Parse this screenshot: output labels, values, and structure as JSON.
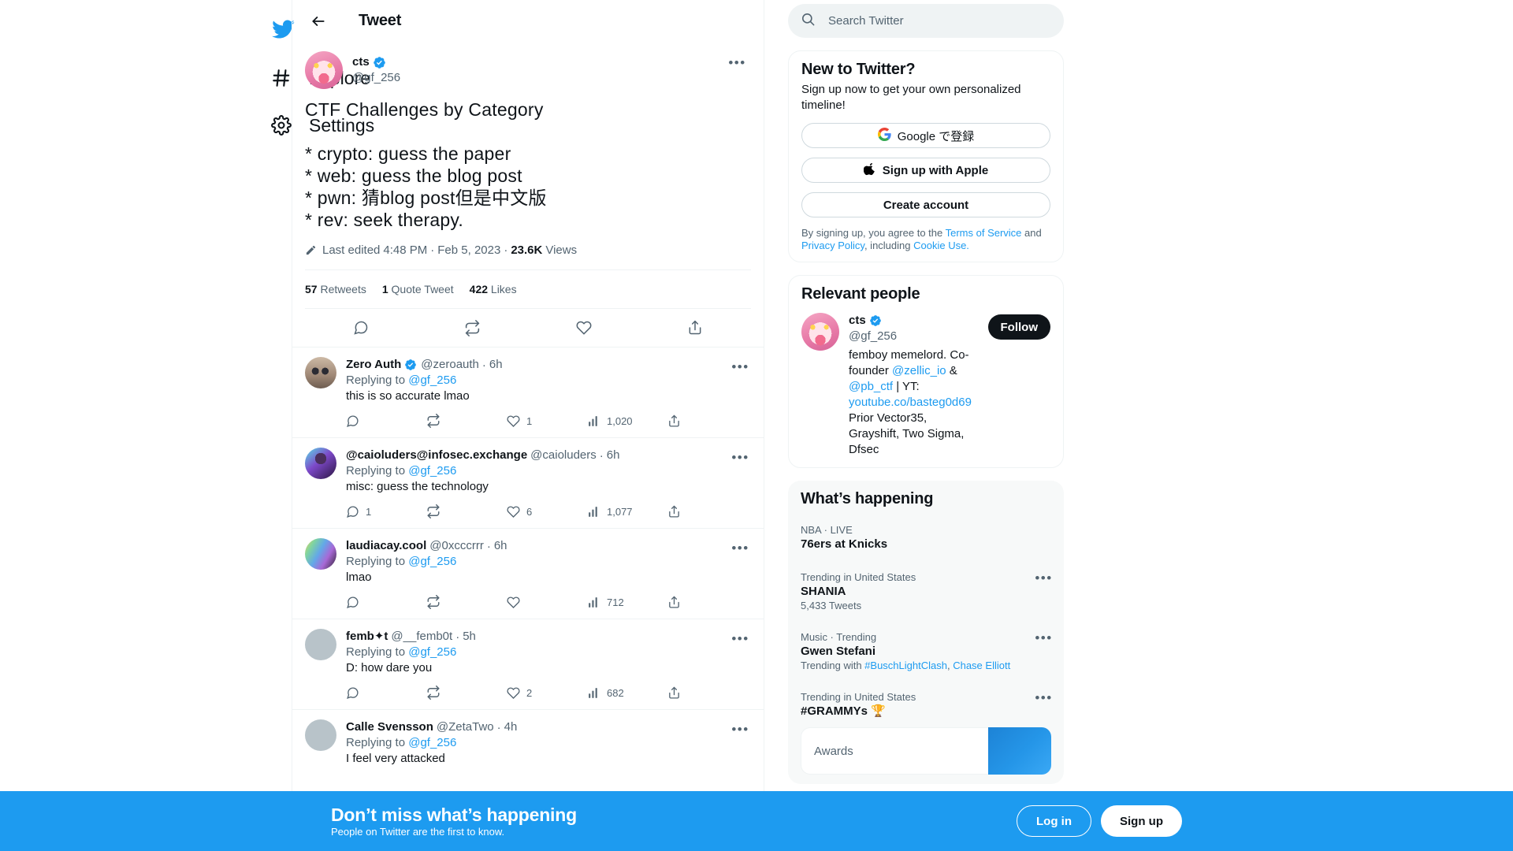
{
  "sidebar": {
    "logo_icon": "twitter-bird-icon",
    "items": [
      {
        "label": "Explore",
        "icon": "hashtag-icon"
      },
      {
        "label": "Settings",
        "icon": "gear-icon"
      }
    ]
  },
  "center": {
    "header": {
      "title": "Tweet",
      "back_icon": "arrow-left-icon"
    },
    "tweet": {
      "display_name": "cts",
      "verified": true,
      "handle": "@gf_256",
      "avatar": "anime-pink-hair-avatar",
      "body": "CTF Challenges by Category\n\n* crypto: guess the paper\n* web: guess the blog post\n* pwn: 猜blog post但是中文版\n* rev: seek therapy.",
      "meta_prefix": "Last edited",
      "time": "4:48 PM",
      "date": "Feb 5, 2023",
      "views_count": "23.6K",
      "views_label": "Views",
      "edit_icon": "pencil-icon",
      "stats": [
        {
          "value": "57",
          "label": "Retweets"
        },
        {
          "value": "1",
          "label": "Quote Tweet"
        },
        {
          "value": "422",
          "label": "Likes"
        }
      ],
      "actions": [
        "reply-icon",
        "retweet-icon",
        "like-icon",
        "share-icon"
      ]
    },
    "replies": [
      {
        "display_name": "Zero Auth",
        "verified": true,
        "handle": "@zeroauth",
        "time": "6h",
        "avatar": "bald-sunglasses-avatar",
        "replying_to_label": "Replying to",
        "replying_to": "@gf_256",
        "text": "this is so accurate lmao",
        "replies_count": "",
        "retweets_count": "",
        "likes_count": "1",
        "views_count": "1,020"
      },
      {
        "display_name": "@caioluders@infosec.exchange",
        "verified": false,
        "handle": "@caioluders",
        "time": "6h",
        "avatar": "purple-neon-avatar",
        "replying_to_label": "Replying to",
        "replying_to": "@gf_256",
        "text": "misc: guess the technology",
        "replies_count": "1",
        "retweets_count": "",
        "likes_count": "6",
        "views_count": "1,077"
      },
      {
        "display_name": "laudiacay.cool",
        "verified": false,
        "handle": "@0xcccrrr",
        "time": "6h",
        "avatar": "rainbow-hair-avatar",
        "replying_to_label": "Replying to",
        "replying_to": "@gf_256",
        "text": "lmao",
        "replies_count": "",
        "retweets_count": "",
        "likes_count": "",
        "views_count": "712"
      },
      {
        "display_name": "femb✦t",
        "verified": false,
        "handle": "@__femb0t",
        "time": "5h",
        "avatar": "default-avatar",
        "replying_to_label": "Replying to",
        "replying_to": "@gf_256",
        "text": "D: how dare you",
        "replies_count": "",
        "retweets_count": "",
        "likes_count": "2",
        "views_count": "682"
      },
      {
        "display_name": "Calle Svensson",
        "verified": false,
        "handle": "@ZetaTwo",
        "time": "4h",
        "avatar": "default-avatar",
        "replying_to_label": "Replying to",
        "replying_to": "@gf_256",
        "text": "I feel very attacked",
        "replies_count": "",
        "retweets_count": "",
        "likes_count": "",
        "views_count": ""
      }
    ]
  },
  "search": {
    "placeholder": "Search Twitter",
    "value": "",
    "icon": "search-icon"
  },
  "signup_card": {
    "title": "New to Twitter?",
    "subtitle": "Sign up now to get your own personalized timeline!",
    "google_label": "Google で登録",
    "google_icon": "google-g-icon",
    "apple_label": "Sign up with Apple",
    "apple_icon": "apple-logo-icon",
    "create_label": "Create account",
    "legal_pre": "By signing up, you agree to the ",
    "legal_tos": "Terms of Service",
    "legal_and": " and ",
    "legal_privacy": "Privacy Policy",
    "legal_including": ", including ",
    "legal_cookie": "Cookie Use."
  },
  "relevant_people": {
    "title": "Relevant people",
    "person": {
      "display_name": "cts",
      "verified": true,
      "handle": "@gf_256",
      "follow_label": "Follow",
      "bio_1": "femboy memelord. Co-founder ",
      "bio_link_1": "@zellic_io",
      "bio_amp": " & ",
      "bio_link_2": "@pb_ctf",
      "bio_2": " | YT: ",
      "bio_link_3": "youtube.co/basteg0d69",
      "bio_3": " Prior Vector35, Grayshift, Two Sigma, Dfsec"
    }
  },
  "whats_happening": {
    "title": "What’s happening",
    "items": [
      {
        "context": "NBA · LIVE",
        "name": "76ers at Knicks",
        "count": "",
        "with_prefix": "",
        "with_links": [],
        "has_more": false
      },
      {
        "context": "Trending in United States",
        "name": "SHANIA",
        "count": "5,433 Tweets",
        "with_prefix": "",
        "with_links": [],
        "has_more": true
      },
      {
        "context": "Music · Trending",
        "name": "Gwen Stefani",
        "count": "",
        "with_prefix": "Trending with ",
        "with_links": [
          "#BuschLightClash",
          "Chase Elliott"
        ],
        "has_more": true
      },
      {
        "context": "Trending in United States",
        "name": "#GRAMMYs 🏆",
        "count": "",
        "with_prefix": "",
        "with_links": [],
        "has_more": true
      }
    ],
    "partial_item": {
      "label": "Awards"
    }
  },
  "bottom_banner": {
    "title": "Don’t miss what’s happening",
    "subtitle": "People on Twitter are the first to know.",
    "login_label": "Log in",
    "signup_label": "Sign up"
  },
  "colors": {
    "brand": "#1d9bf0",
    "text": "#0f1419",
    "muted": "#536471",
    "border": "#eff3f4",
    "panel": "#f7f9f9"
  }
}
